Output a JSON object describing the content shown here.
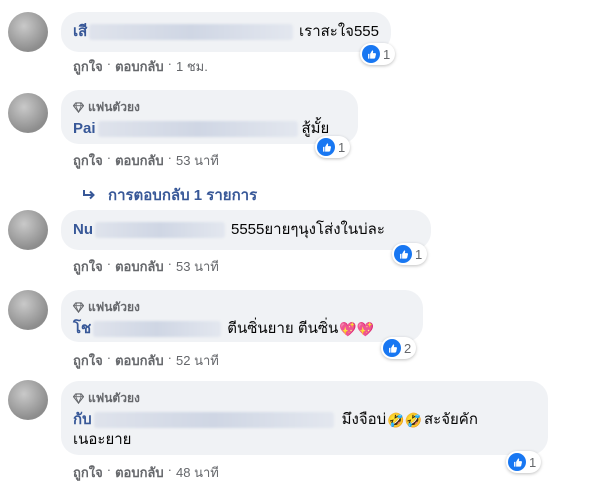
{
  "comments": [
    {
      "name": "เสี",
      "text": "เราสะใจ555",
      "fan_badge": "",
      "reactions": "1",
      "actions": {
        "like": "ถูกใจ",
        "reply": "ตอบกลับ",
        "time": "1 ชม.",
        "sep": "·"
      }
    },
    {
      "name": "Pai",
      "text": "สู้มั้ย",
      "fan_badge": "แฟนตัวยง",
      "reactions": "1",
      "actions": {
        "like": "ถูกใจ",
        "reply": "ตอบกลับ",
        "time": "53 นาที",
        "sep": "·"
      }
    },
    {
      "name": "Nu",
      "text": "5555ยายๆนุงโส่งในบ่ละ",
      "fan_badge": "",
      "reactions": "1",
      "actions": {
        "like": "ถูกใจ",
        "reply": "ตอบกลับ",
        "time": "53 นาที",
        "sep": "·"
      }
    },
    {
      "name": "โช",
      "text": "ตีนซิ่นยาย ตีนซิ่น",
      "emoji": "💖💖",
      "fan_badge": "แฟนตัวยง",
      "reactions": "2",
      "actions": {
        "like": "ถูกใจ",
        "reply": "ตอบกลับ",
        "time": "52 นาที",
        "sep": "·"
      }
    },
    {
      "name": "กับ",
      "text_a": "มึงจือบ่",
      "emoji_a": "🤣🤣",
      "text_b": "สะจัยคัก",
      "text_line2": "เนอะยาย",
      "fan_badge": "แฟนตัวยง",
      "reactions": "1",
      "actions": {
        "like": "ถูกใจ",
        "reply": "ตอบกลับ",
        "time": "48 นาที",
        "sep": "·"
      }
    }
  ],
  "replies_link": "การตอบกลับ 1 รายการ",
  "icons": {
    "like": "like-icon",
    "badge": "diamond-icon",
    "reply": "reply-arrow-icon"
  },
  "colors": {
    "bubble": "#f0f2f5",
    "name": "#385898",
    "like": "#1877f2",
    "meta": "#65676b"
  }
}
